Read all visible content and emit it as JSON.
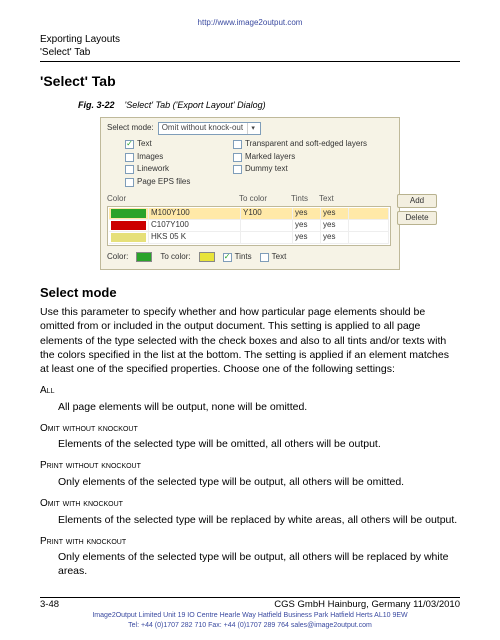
{
  "header": {
    "url": "http://www.image2output.com",
    "line1": "Exporting Layouts",
    "line2": "'Select' Tab"
  },
  "title": "'Select' Tab",
  "figure": {
    "label": "Fig. 3-22",
    "caption": "'Select' Tab ('Export Layout' Dialog)"
  },
  "dialog": {
    "select_mode_label": "Select mode:",
    "select_mode_value": "Omit without knock-out",
    "checks": {
      "text": {
        "label": "Text",
        "checked": true
      },
      "transparent": {
        "label": "Transparent and soft-edged layers",
        "checked": false
      },
      "images": {
        "label": "Images",
        "checked": false
      },
      "marked_layers": {
        "label": "Marked layers",
        "checked": false
      },
      "linework": {
        "label": "Linework",
        "checked": false
      },
      "dummy_text": {
        "label": "Dummy text",
        "checked": false
      },
      "page_eps": {
        "label": "Page EPS files",
        "checked": false
      }
    },
    "table": {
      "headers": {
        "color": "Color",
        "to_color": "To color",
        "tints": "Tints",
        "text": "Text"
      },
      "rows": [
        {
          "swatch": "#2aa32a",
          "name": "M100Y100",
          "to_color": "Y100",
          "tints": "yes",
          "text": "yes",
          "selected": true
        },
        {
          "swatch": "#cc0000",
          "name": "C107Y100",
          "to_color": "",
          "tints": "yes",
          "text": "yes",
          "selected": false
        },
        {
          "swatch": "#e6e07a",
          "name": "HKS 05 K",
          "to_color": "",
          "tints": "yes",
          "text": "yes",
          "selected": false
        }
      ]
    },
    "buttons": {
      "add": "Add",
      "delete": "Delete"
    },
    "foot": {
      "color_label": "Color:",
      "color_swatch": "#2aa32a",
      "to_color_label": "To color:",
      "to_color_swatch": "#e8e43a",
      "tints_label": "Tints",
      "tints_checked": true,
      "text_label": "Text",
      "text_checked": false
    }
  },
  "section_heading": "Select mode",
  "intro": "Use this parameter to specify whether and how particular page elements should be omitted from or included in the output document. This setting is applied to all page elements of the type selected with the check boxes and also to all tints and/or texts with the colors specified in the list at the bottom. The setting is applied if an element matches at least one of the specified properties. Choose one of the following settings:",
  "options": [
    {
      "title": "All",
      "body": "All page elements will be output, none will be omitted."
    },
    {
      "title": "Omit without knockout",
      "body": "Elements of the selected type will be omitted, all others will be output."
    },
    {
      "title": "Print without knockout",
      "body": "Only elements of the selected type will be output, all others will be omitted."
    },
    {
      "title": "Omit with knockout",
      "body": "Elements of the selected type will be replaced by white areas, all others will be output."
    },
    {
      "title": "Print with knockout",
      "body": "Only elements of the selected type will be output, all others will be replaced by white areas."
    }
  ],
  "footer": {
    "page": "3-48",
    "right": "CGS GmbH    Hainburg, Germany    11/03/2010",
    "tiny1": "Image2Output Limited  Unit 19 IO Centre Hearle Way Hatfield Business Park Hatfield Herts AL10 9EW",
    "tiny2": "Tel: +44 (0)1707 282 710 Fax: +44 (0)1707 289 764 sales@image2output.com"
  }
}
